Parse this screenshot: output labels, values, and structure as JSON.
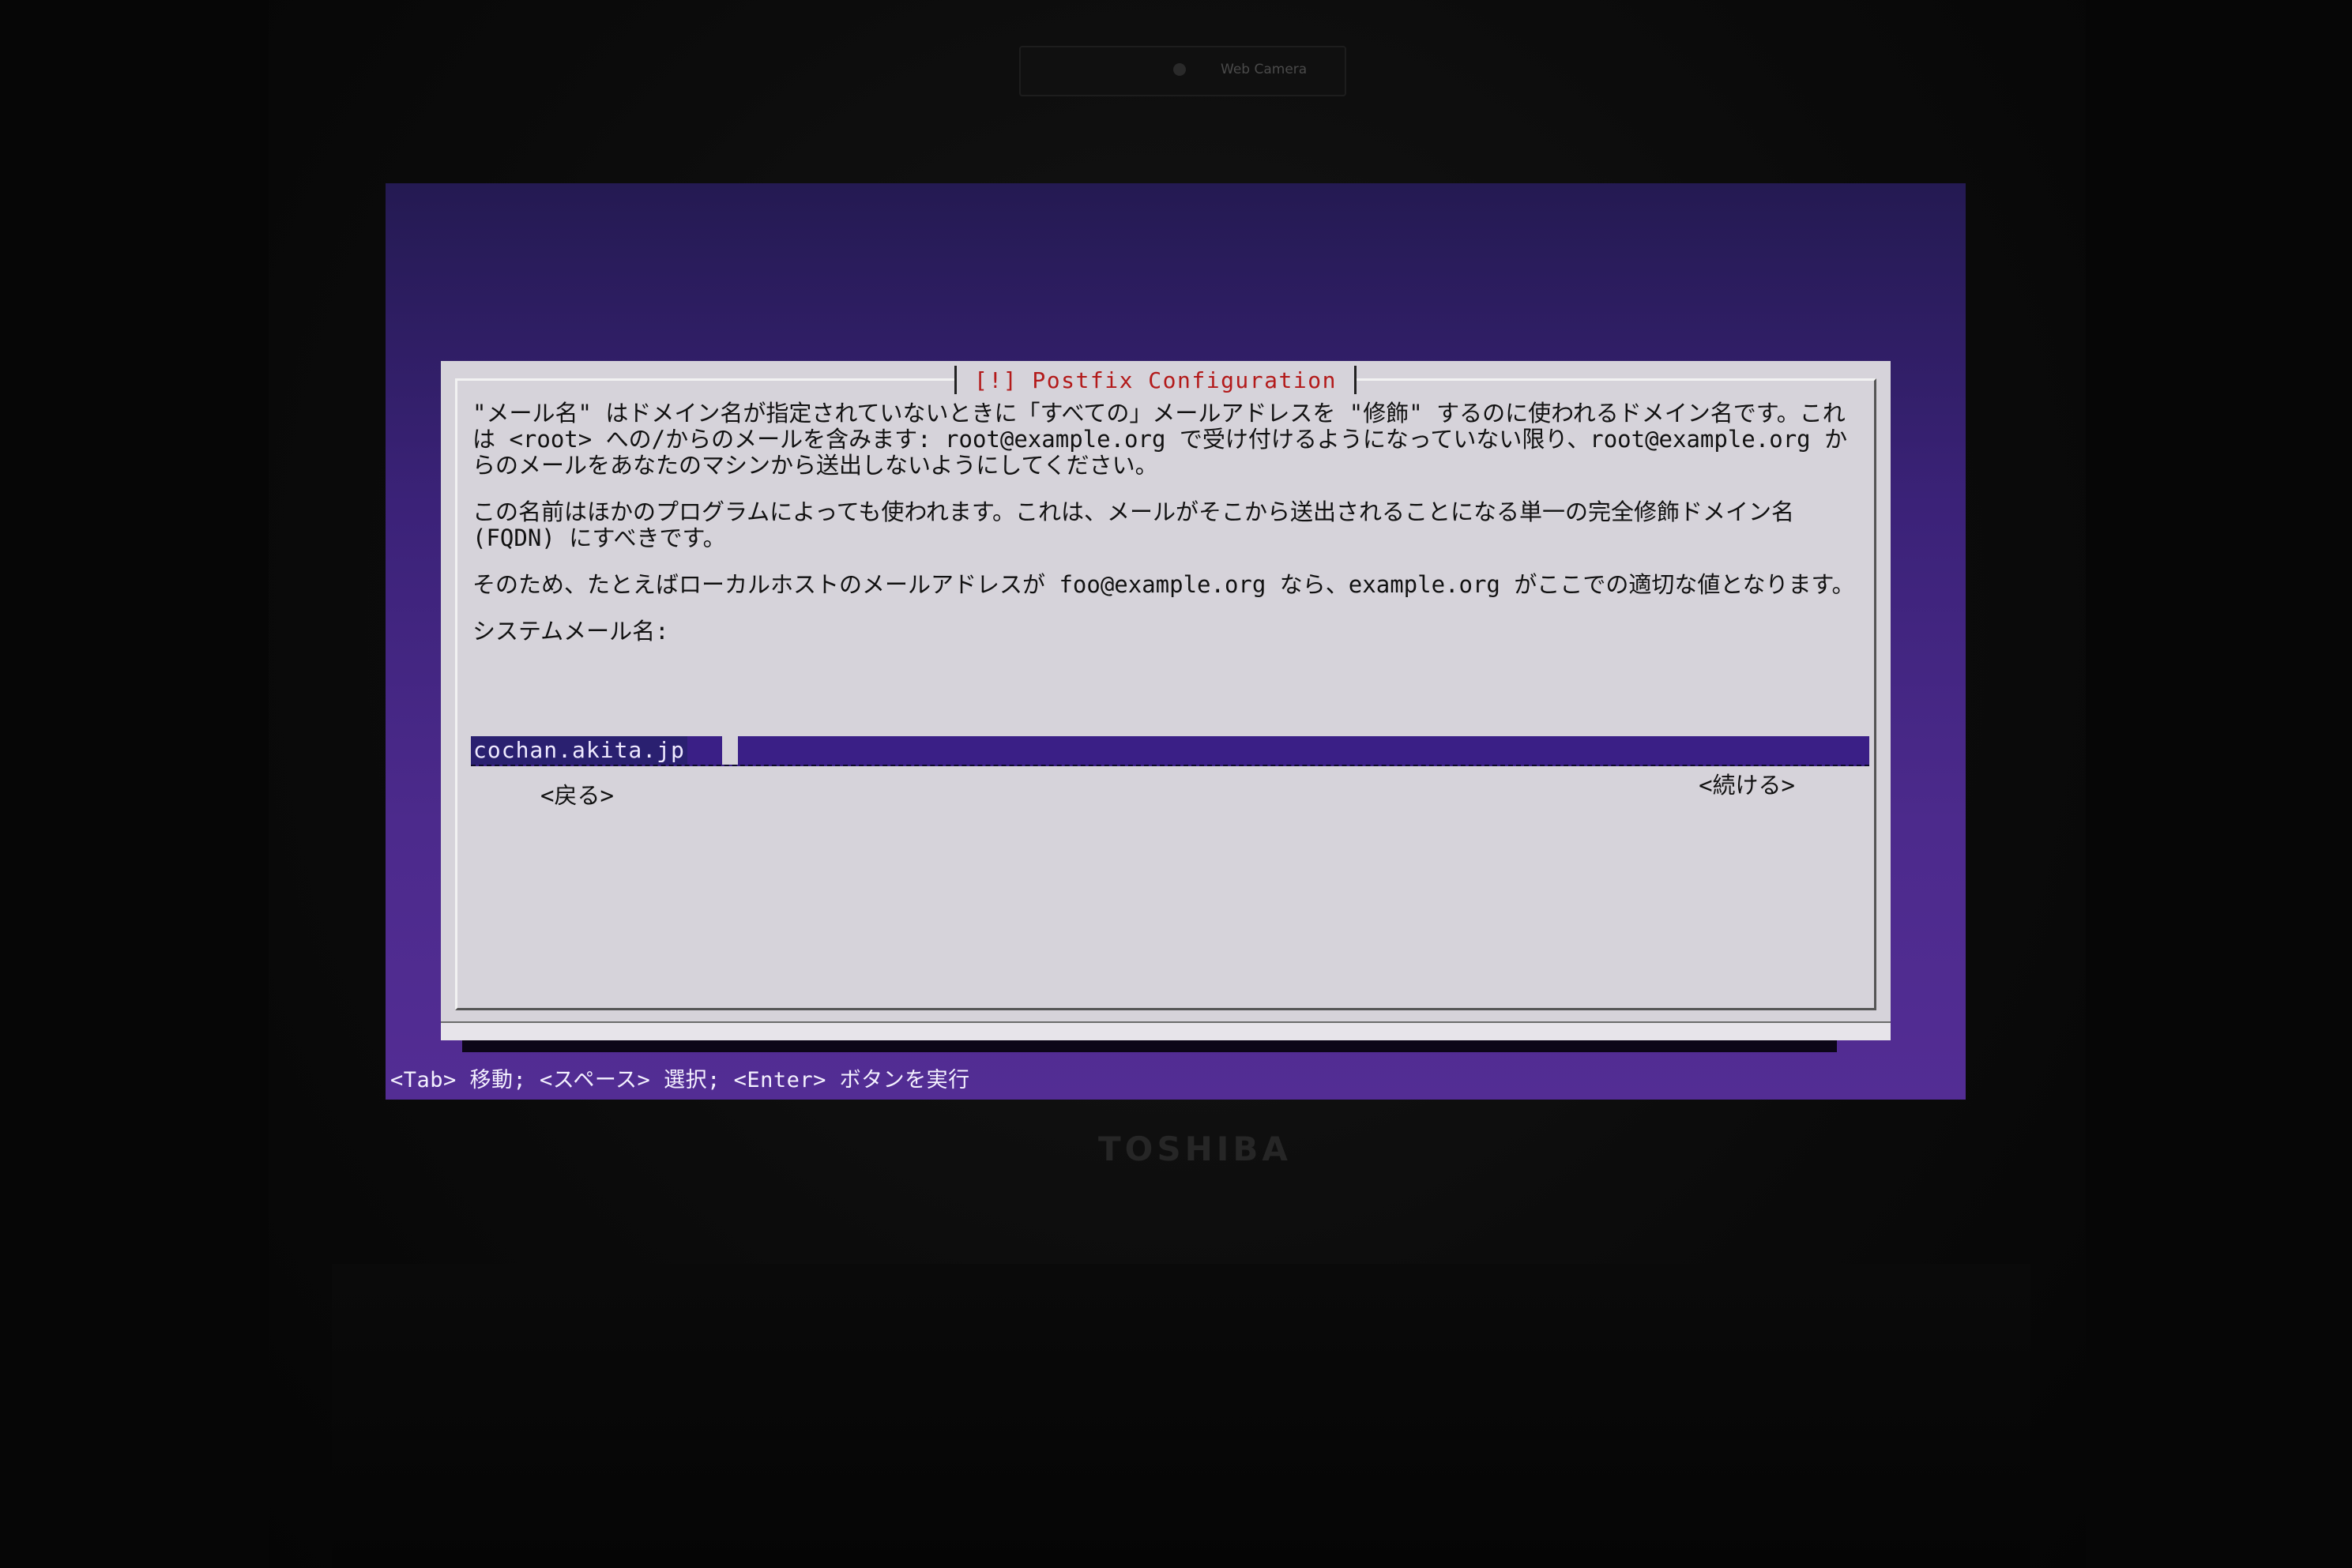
{
  "device": {
    "webcam_label": "Web Camera",
    "brand": "TOSHIBA"
  },
  "dialog": {
    "title": "[!] Postfix Configuration",
    "paragraphs": [
      "\"メール名\" はドメイン名が指定されていないときに「すべての」メールアドレスを \"修飾\" するのに使われるドメイン名です。これは <root> への/からのメールを含みます: root@example.org で受け付けるようになっていない限り、root@example.org からのメールをあなたのマシンから送出しないようにしてください。",
      "この名前はほかのプログラムによっても使われます。これは、メールがそこから送出されることになる単一の完全修飾ドメイン名 (FQDN) にすべきです。",
      "そのため、たとえばローカルホストのメールアドレスが foo@example.org なら、example.org がここでの適切な値となります。"
    ],
    "prompt_label": "システムメール名:",
    "input_value": "cochan.akita.jp",
    "back_button": "<戻る>",
    "continue_button": "<続ける>"
  },
  "helpbar": {
    "text": "<Tab> 移動; <スペース> 選択; <Enter> ボタンを実行"
  },
  "colors": {
    "screen_background": "#4c2a8c",
    "dialog_background": "#d6d3da",
    "title_color": "#b31a1a",
    "input_field": "#3a1f86"
  }
}
